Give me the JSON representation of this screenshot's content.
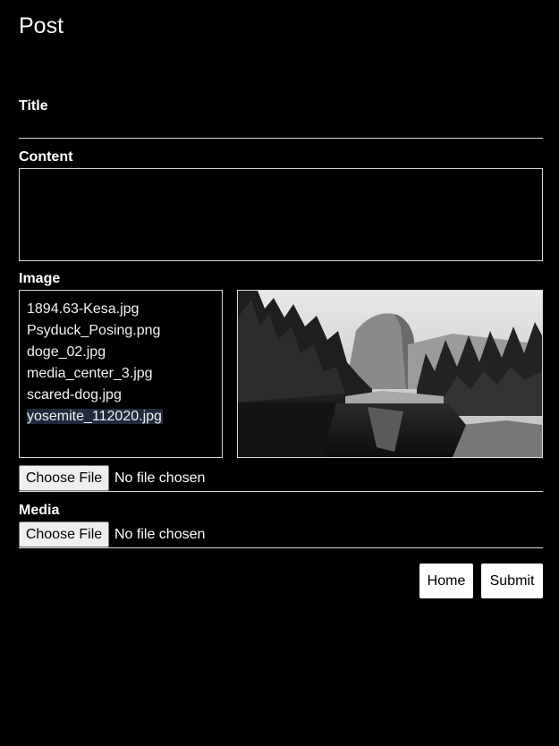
{
  "page": {
    "title": "Post"
  },
  "form": {
    "title_label": "Title",
    "title_value": "",
    "content_label": "Content",
    "content_value": "",
    "image_label": "Image",
    "image_files": [
      "1894.63-Kesa.jpg",
      "Psyduck_Posing.png",
      "doge_02.jpg",
      "media_center_3.jpg",
      "scared-dog.jpg",
      "yosemite_112020.jpg"
    ],
    "image_selected": "yosemite_112020.jpg",
    "image_file_button": "Choose File",
    "image_file_status": "No file chosen",
    "media_label": "Media",
    "media_file_button": "Choose File",
    "media_file_status": "No file chosen"
  },
  "actions": {
    "home_label": "Home",
    "submit_label": "Submit"
  },
  "preview": {
    "icon": "image-preview-yosemite-half-dome"
  },
  "colors": {
    "background": "#000000",
    "text": "#ffffff",
    "border": "#d9d9d9",
    "selection": "#1f2a3d"
  }
}
